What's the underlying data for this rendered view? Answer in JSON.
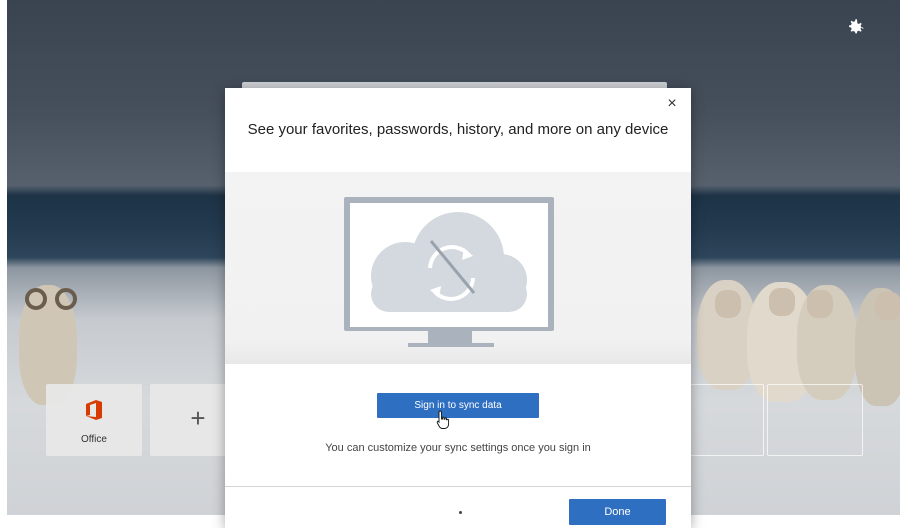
{
  "page": {
    "settings_icon": "gear-icon"
  },
  "quick_links": {
    "office_label": "Office",
    "office_icon": "office-logo-icon",
    "add_symbol": "+",
    "add_icon": "plus-icon"
  },
  "dialog": {
    "title": "See your favorites, passwords, history, and more on any device",
    "close_symbol": "×",
    "illustration_icon": "monitor-cloud-sync-disabled-icon",
    "sign_in_label": "Sign in to sync data",
    "hint": "You can customize your sync settings once you sign in",
    "done_label": "Done"
  },
  "colors": {
    "accent": "#2f6fc2",
    "illustration_frame": "#aab3bd",
    "cloud": "#d4d9df",
    "office_brand": "#d83b01"
  }
}
